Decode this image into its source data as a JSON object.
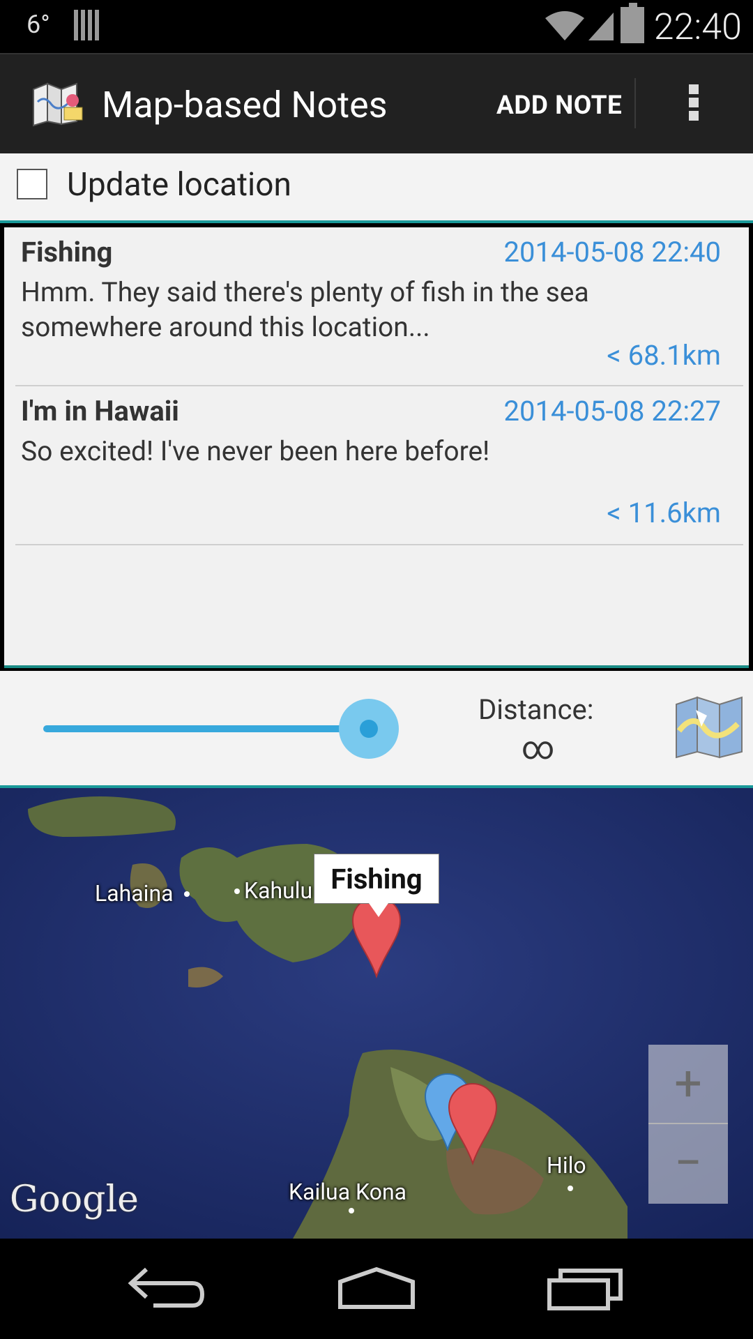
{
  "status_bar": {
    "temperature": "6°",
    "time": "22:40"
  },
  "action_bar": {
    "title": "Map-based Notes",
    "add_note": "ADD NOTE"
  },
  "update_location": {
    "label": "Update location",
    "checked": false
  },
  "notes": [
    {
      "title": "Fishing",
      "date": "2014-05-08 22:40",
      "body": "Hmm. They said there's plenty of fish in the sea somewhere around this location...",
      "distance": "< 68.1km"
    },
    {
      "title": "I'm in Hawaii",
      "date": "2014-05-08 22:27",
      "body": "So excited! I've never been here before!",
      "distance": "< 11.6km"
    }
  ],
  "distance_control": {
    "label": "Distance:",
    "value": "∞",
    "slider_level": 1.0
  },
  "map": {
    "labels": {
      "lahaina": "Lahaina",
      "kahului": "Kahulu",
      "kailua_kona": "Kailua Kona",
      "hilo": "Hilo"
    },
    "info_window": "Fishing",
    "attribution": "Google",
    "zoom_in": "+",
    "zoom_out": "−",
    "colors": {
      "ocean": "#1d2d6a",
      "marker_red": "#e8575a",
      "marker_blue": "#62a8e8"
    }
  },
  "nav_bar": {
    "icons": [
      "back-icon",
      "home-icon",
      "recents-icon"
    ]
  },
  "colors": {
    "accent": "#1a9a9a",
    "link": "#3a8fd8",
    "slider": "#37a8dc"
  }
}
